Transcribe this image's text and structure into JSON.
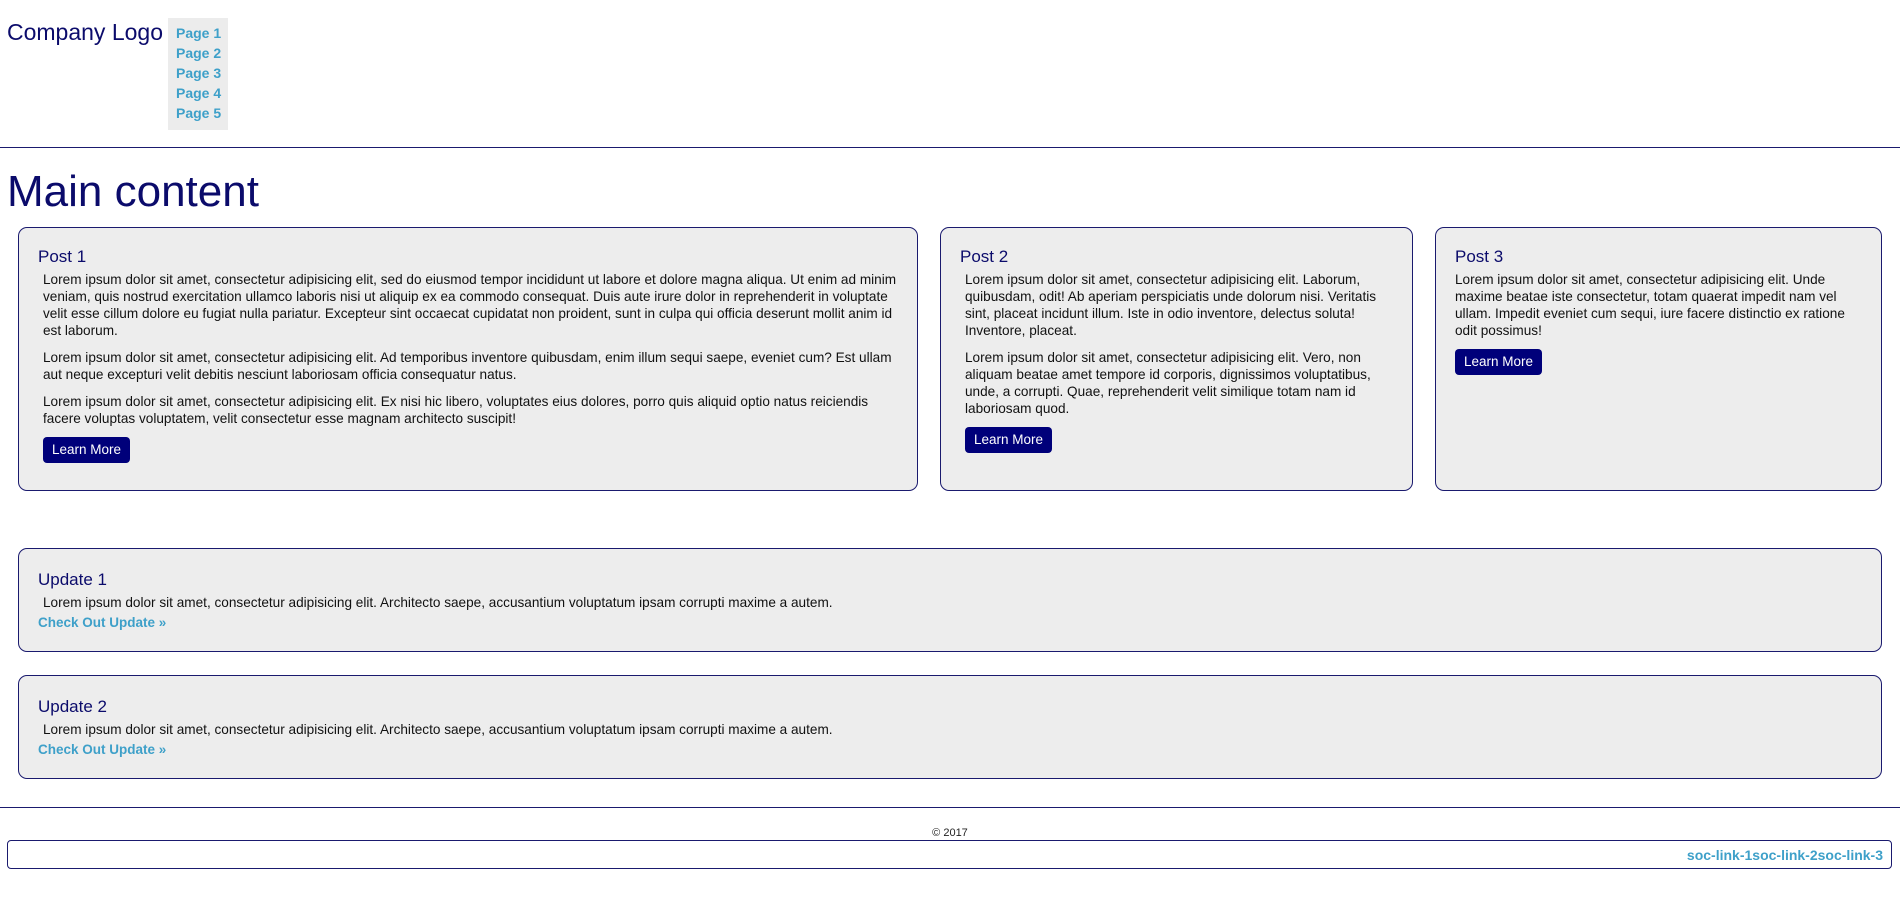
{
  "header": {
    "logo": "Company Logo",
    "nav": [
      "Page 1",
      "Page 2",
      "Page 3",
      "Page 4",
      "Page 5"
    ]
  },
  "main": {
    "title": "Main content",
    "posts": [
      {
        "title": "Post 1",
        "paragraphs": [
          "Lorem ipsum dolor sit amet, consectetur adipisicing elit, sed do eiusmod tempor incididunt ut labore et dolore magna aliqua. Ut enim ad minim veniam, quis nostrud exercitation ullamco laboris nisi ut aliquip ex ea commodo consequat. Duis aute irure dolor in reprehenderit in voluptate velit esse cillum dolore eu fugiat nulla pariatur. Excepteur sint occaecat cupidatat non proident, sunt in culpa qui officia deserunt mollit anim id est laborum.",
          "Lorem ipsum dolor sit amet, consectetur adipisicing elit. Ad temporibus inventore quibusdam, enim illum sequi saepe, eveniet cum? Est ullam aut neque excepturi velit debitis nesciunt laboriosam officia consequatur natus.",
          "Lorem ipsum dolor sit amet, consectetur adipisicing elit. Ex nisi hic libero, voluptates eius dolores, porro quis aliquid optio natus reiciendis facere voluptas voluptatem, velit consectetur esse magnam architecto suscipit!"
        ],
        "button": "Learn More"
      },
      {
        "title": "Post 2",
        "paragraphs": [
          "Lorem ipsum dolor sit amet, consectetur adipisicing elit. Laborum, quibusdam, odit! Ab aperiam perspiciatis unde dolorum nisi. Veritatis sint, placeat incidunt illum. Iste in odio inventore, delectus soluta! Inventore, placeat.",
          "Lorem ipsum dolor sit amet, consectetur adipisicing elit. Vero, non aliquam beatae amet tempore id corporis, dignissimos voluptatibus, unde, a corrupti. Quae, reprehenderit velit similique totam nam id laboriosam quod."
        ],
        "button": "Learn More"
      },
      {
        "title": "Post 3",
        "paragraphs": [
          "Lorem ipsum dolor sit amet, consectetur adipisicing elit. Unde maxime beatae iste consectetur, totam quaerat impedit nam vel ullam. Impedit eveniet cum sequi, iure facere distinctio ex ratione odit possimus!"
        ],
        "button": "Learn More"
      }
    ],
    "updates": [
      {
        "title": "Update 1",
        "text": "Lorem ipsum dolor sit amet, consectetur adipisicing elit. Architecto saepe, accusantium voluptatum ipsam corrupti maxime a autem.",
        "link": "Check Out Update »"
      },
      {
        "title": "Update 2",
        "text": "Lorem ipsum dolor sit amet, consectetur adipisicing elit. Architecto saepe, accusantium voluptatum ipsam corrupti maxime a autem.",
        "link": "Check Out Update »"
      }
    ]
  },
  "footer": {
    "copyright": "© 2017",
    "social_links": [
      "soc-link-1",
      "soc-link-2",
      "soc-link-3"
    ]
  },
  "colors": {
    "accent_navy": "#0b0b6b",
    "button_bg": "#00007a",
    "link": "#3ea0c9",
    "card_bg": "#ededed"
  }
}
